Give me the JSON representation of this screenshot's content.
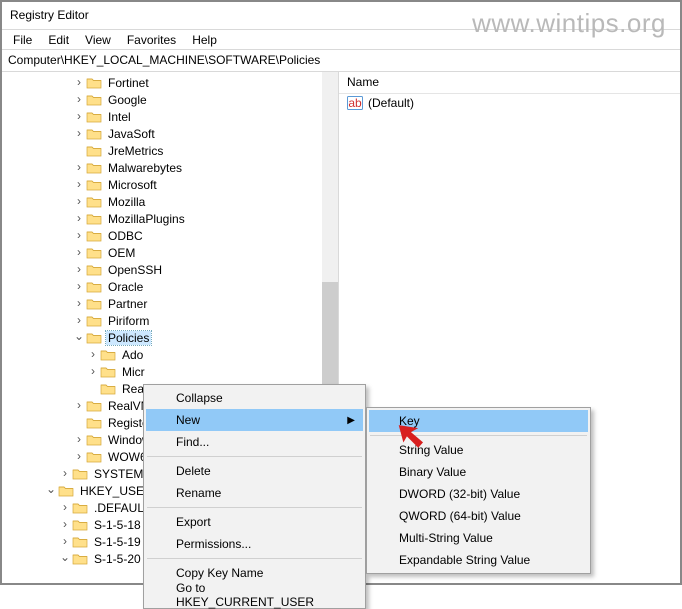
{
  "watermark": "www.wintips.org",
  "window_title": "Registry Editor",
  "menu": {
    "file": "File",
    "edit": "Edit",
    "view": "View",
    "favorites": "Favorites",
    "help": "Help"
  },
  "address": "Computer\\HKEY_LOCAL_MACHINE\\SOFTWARE\\Policies",
  "tree": {
    "items": [
      {
        "label": "Fortinet",
        "indent": 5,
        "chev": "closed"
      },
      {
        "label": "Google",
        "indent": 5,
        "chev": "closed"
      },
      {
        "label": "Intel",
        "indent": 5,
        "chev": "closed"
      },
      {
        "label": "JavaSoft",
        "indent": 5,
        "chev": "closed"
      },
      {
        "label": "JreMetrics",
        "indent": 5,
        "chev": ""
      },
      {
        "label": "Malwarebytes",
        "indent": 5,
        "chev": "closed"
      },
      {
        "label": "Microsoft",
        "indent": 5,
        "chev": "closed"
      },
      {
        "label": "Mozilla",
        "indent": 5,
        "chev": "closed"
      },
      {
        "label": "MozillaPlugins",
        "indent": 5,
        "chev": "closed"
      },
      {
        "label": "ODBC",
        "indent": 5,
        "chev": "closed"
      },
      {
        "label": "OEM",
        "indent": 5,
        "chev": "closed"
      },
      {
        "label": "OpenSSH",
        "indent": 5,
        "chev": "closed"
      },
      {
        "label": "Oracle",
        "indent": 5,
        "chev": "closed"
      },
      {
        "label": "Partner",
        "indent": 5,
        "chev": "closed"
      },
      {
        "label": "Piriform",
        "indent": 5,
        "chev": "closed"
      },
      {
        "label": "Policies",
        "indent": 5,
        "chev": "open",
        "selected": true
      },
      {
        "label": "Ado",
        "indent": 6,
        "chev": "closed"
      },
      {
        "label": "Micr",
        "indent": 6,
        "chev": "closed"
      },
      {
        "label": "Real",
        "indent": 6,
        "chev": ""
      },
      {
        "label": "RealVN",
        "indent": 5,
        "chev": "closed"
      },
      {
        "label": "Registe",
        "indent": 5,
        "chev": ""
      },
      {
        "label": "Window",
        "indent": 5,
        "chev": "closed"
      },
      {
        "label": "WOW6",
        "indent": 5,
        "chev": "closed"
      },
      {
        "label": "SYSTEM",
        "indent": 4,
        "chev": "closed"
      },
      {
        "label": "HKEY_USERS",
        "indent": 3,
        "chev": "open"
      },
      {
        "label": ".DEFAULT",
        "indent": 4,
        "chev": "closed"
      },
      {
        "label": "S-1-5-18",
        "indent": 4,
        "chev": "closed"
      },
      {
        "label": "S-1-5-19",
        "indent": 4,
        "chev": "closed"
      },
      {
        "label": "S-1-5-20",
        "indent": 4,
        "chev": "open"
      }
    ]
  },
  "list": {
    "header_name": "Name",
    "default_value": "(Default)"
  },
  "ctx": {
    "collapse": "Collapse",
    "new": "New",
    "find": "Find...",
    "delete": "Delete",
    "rename": "Rename",
    "export": "Export",
    "permissions": "Permissions...",
    "copy_key": "Copy Key Name",
    "goto": "Go to HKEY_CURRENT_USER"
  },
  "sub": {
    "key": "Key",
    "string": "String Value",
    "binary": "Binary Value",
    "dword": "DWORD (32-bit) Value",
    "qword": "QWORD (64-bit) Value",
    "multi": "Multi-String Value",
    "expand": "Expandable String Value"
  }
}
